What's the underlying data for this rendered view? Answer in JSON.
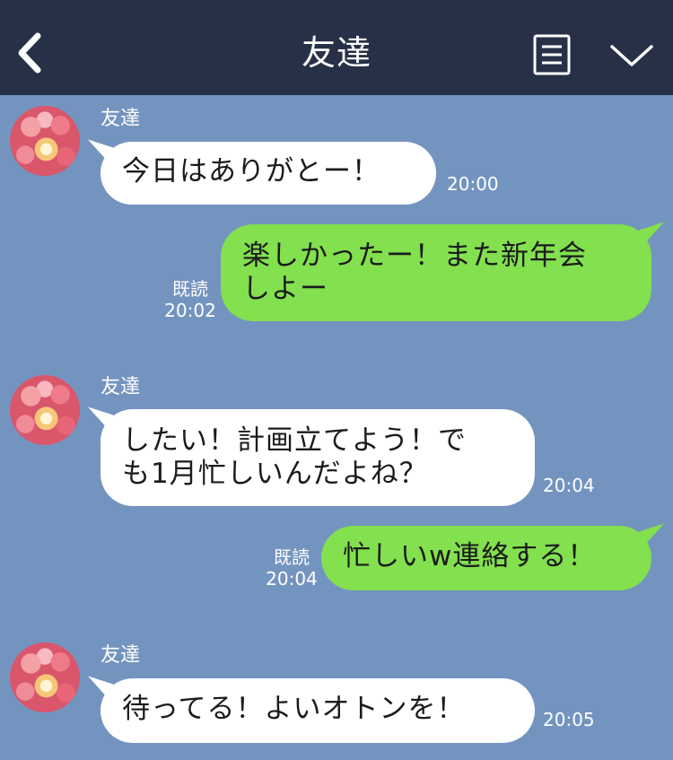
{
  "header": {
    "title": "友達",
    "back_icon": "chevron-left-icon",
    "menu_icon": "menu-icon",
    "more_icon": "chevron-down-icon"
  },
  "colors": {
    "header_bg": "#263147",
    "chat_bg": "#7494c0",
    "incoming_bubble": "#ffffff",
    "outgoing_bubble": "#83e04f"
  },
  "messages": [
    {
      "direction": "incoming",
      "sender": "友達",
      "lines": [
        "今日はありがとー！"
      ],
      "time": "20:00"
    },
    {
      "direction": "outgoing",
      "lines": [
        "楽しかったー！また新年会",
        "しよー"
      ],
      "read_label": "既読",
      "time": "20:02"
    },
    {
      "direction": "incoming",
      "sender": "友達",
      "lines": [
        "したい！計画立てよう！で",
        "も1月忙しいんだよね？"
      ],
      "time": "20:04"
    },
    {
      "direction": "outgoing",
      "lines": [
        "忙しいw連絡する！"
      ],
      "read_label": "既読",
      "time": "20:04"
    },
    {
      "direction": "incoming",
      "sender": "友達",
      "lines": [
        "待ってる！よいオトンを！"
      ],
      "time": "20:05"
    }
  ]
}
